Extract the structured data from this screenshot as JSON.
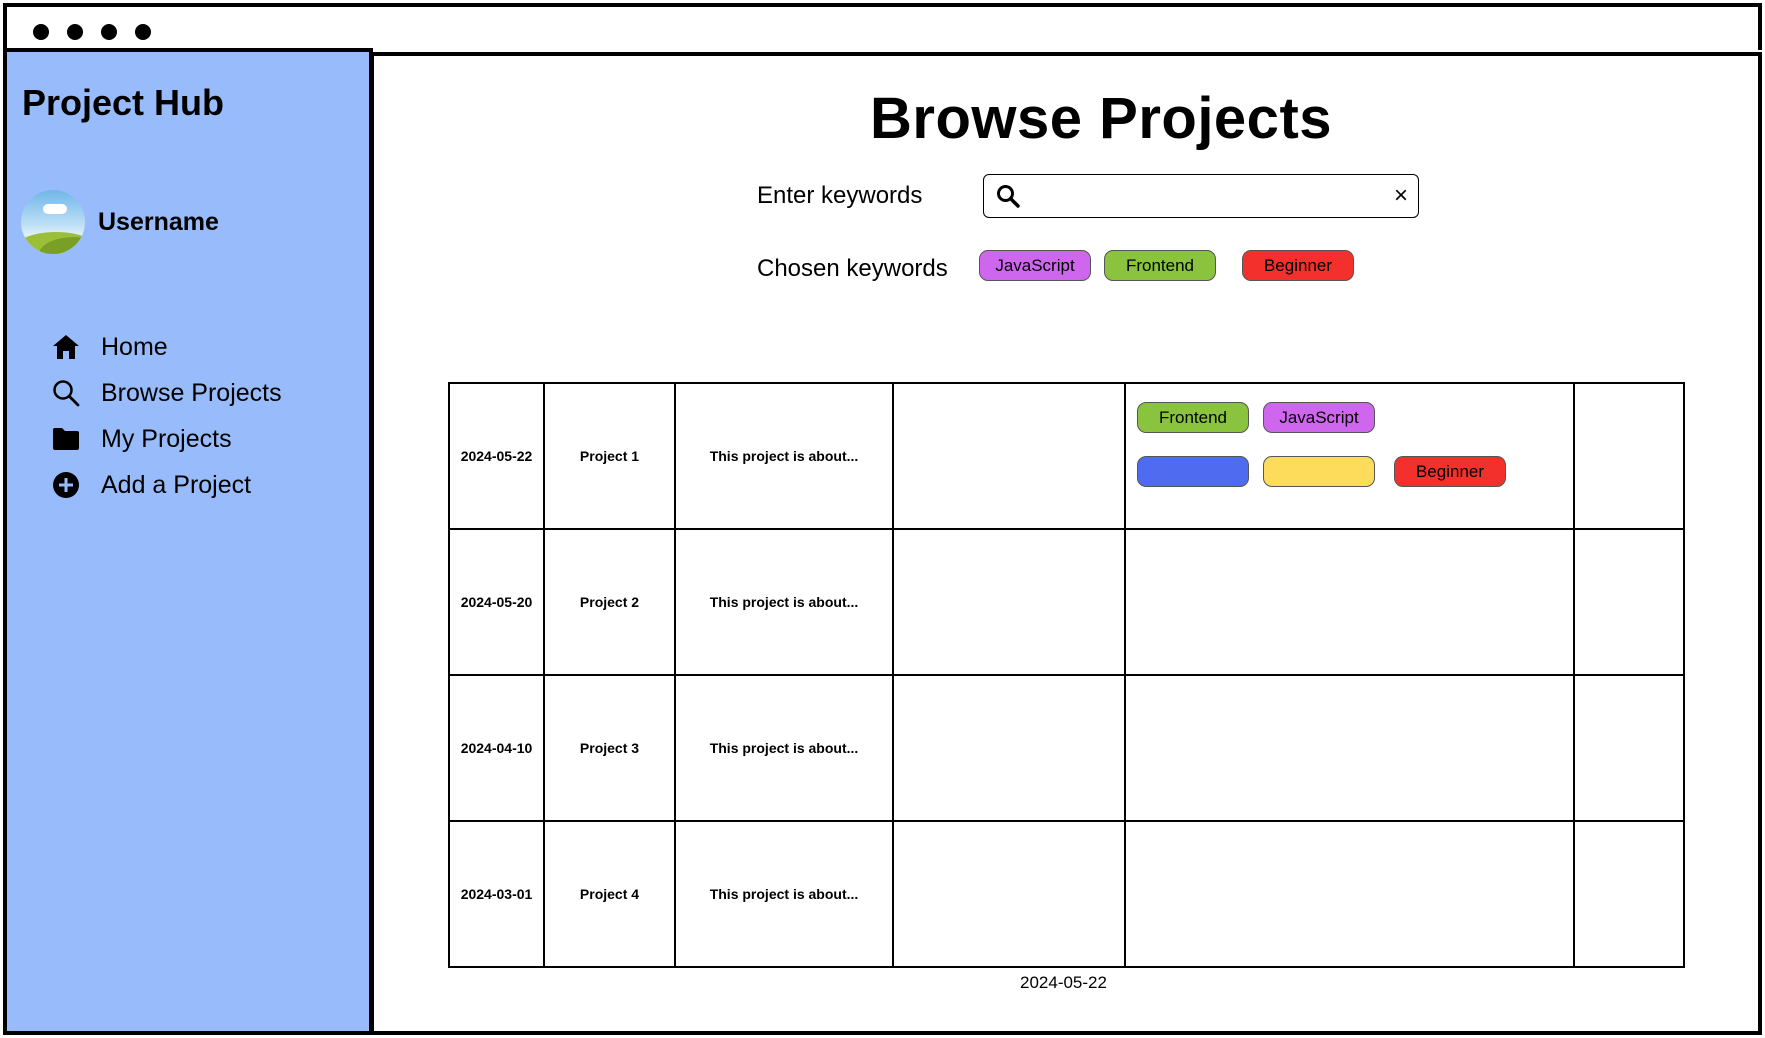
{
  "sidebar": {
    "app_title": "Project Hub",
    "username": "Username",
    "nav": [
      {
        "label": "Home",
        "icon": "home-icon"
      },
      {
        "label": "Browse Projects",
        "icon": "search-icon"
      },
      {
        "label": "My Projects",
        "icon": "folder-icon"
      },
      {
        "label": "Add a Project",
        "icon": "add-circle-icon"
      }
    ]
  },
  "main": {
    "title": "Browse Projects",
    "search": {
      "label": "Enter keywords",
      "value": "",
      "placeholder": "",
      "clear": "×"
    },
    "chosen": {
      "label": "Chosen keywords",
      "chips": [
        {
          "label": "JavaScript",
          "color": "#cf66ee"
        },
        {
          "label": "Frontend",
          "color": "#8ac33e"
        },
        {
          "label": "Beginner",
          "color": "#f4302d"
        }
      ]
    },
    "table": {
      "rows": [
        {
          "date": "2024-05-22",
          "name": "Project 1",
          "description": "This project is about...",
          "tags": [
            {
              "label": "Frontend",
              "color": "#8ac33e"
            },
            {
              "label": "JavaScript",
              "color": "#cf66ee"
            },
            {
              "label": "",
              "color": "#4f6bf0"
            },
            {
              "label": "",
              "color": "#fddc5c"
            },
            {
              "label": "Beginner",
              "color": "#f4302d"
            }
          ]
        },
        {
          "date": "2024-05-20",
          "name": "Project 2",
          "description": "This project is about...",
          "tags": []
        },
        {
          "date": "2024-04-10",
          "name": "Project 3",
          "description": "This project is about...",
          "tags": []
        },
        {
          "date": "2024-03-01",
          "name": "Project 4",
          "description": "This project is about...",
          "tags": []
        }
      ]
    },
    "footer_date": "2024-05-22"
  }
}
